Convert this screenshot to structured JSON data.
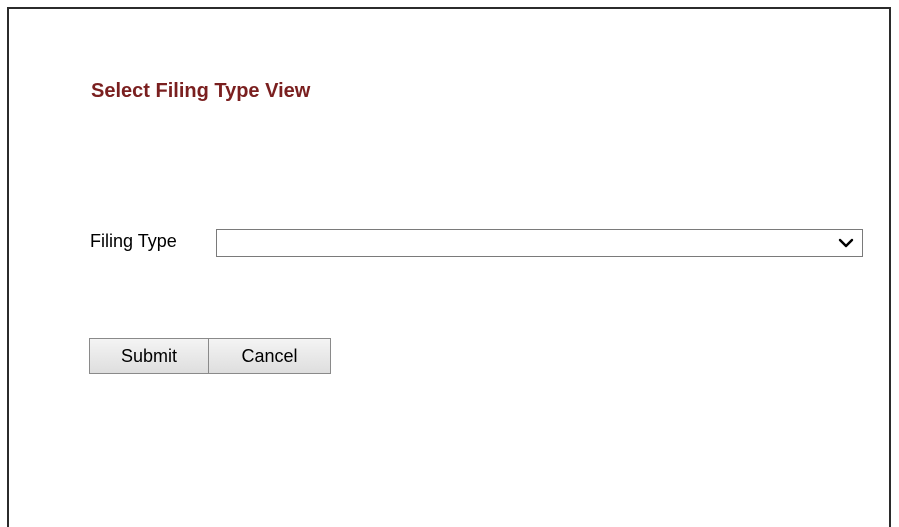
{
  "header": {
    "title": "Select Filing Type View"
  },
  "form": {
    "filing_type_label": "Filing Type",
    "filing_type_value": ""
  },
  "actions": {
    "submit_label": "Submit",
    "cancel_label": "Cancel"
  },
  "colors": {
    "title": "#7a1f1f"
  },
  "icons": {
    "dropdown": "chevron-down-icon"
  }
}
